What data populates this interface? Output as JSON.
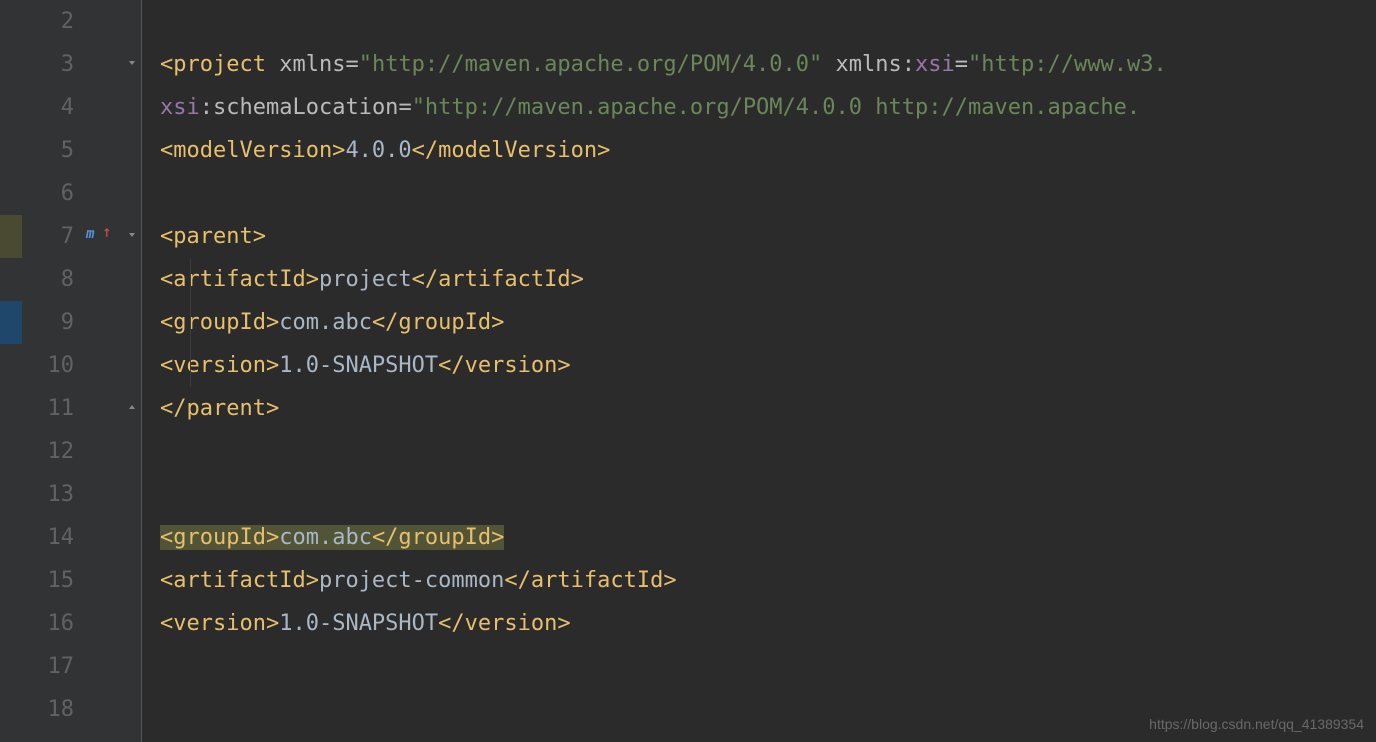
{
  "gutter": {
    "lines": [
      "2",
      "3",
      "4",
      "5",
      "6",
      "7",
      "8",
      "9",
      "10",
      "11",
      "12",
      "13",
      "14",
      "15",
      "16",
      "17",
      "18"
    ]
  },
  "code": {
    "l3": {
      "project_open": "<project",
      "sp1": " ",
      "xmlns": "xmlns",
      "eq": "=",
      "xmlns_val": "\"http://maven.apache.org/POM/4.0.0\"",
      "sp2": " ",
      "xmlns2": "xmlns",
      "colon": ":",
      "xsi": "xsi",
      "eq2": "=",
      "xsi_val": "\"http://www.w3."
    },
    "l4": {
      "xsi": "xsi",
      "colon": ":",
      "schemaLocation": "schemaLocation",
      "eq": "=",
      "val": "\"http://maven.apache.org/POM/4.0.0 http://maven.apache."
    },
    "l5": {
      "open": "<modelVersion>",
      "val": "4.0.0",
      "close": "</modelVersion>"
    },
    "l7": {
      "open": "<parent>"
    },
    "l8": {
      "open": "<artifactId>",
      "val": "project",
      "close": "</artifactId>"
    },
    "l9": {
      "open": "<groupId>",
      "val": "com.abc",
      "close": "</groupId>"
    },
    "l10": {
      "open": "<version>",
      "val": "1.0-SNAPSHOT",
      "close": "</version>"
    },
    "l11": {
      "close": "</parent>"
    },
    "l14": {
      "open": "<groupId>",
      "val": "com.abc",
      "close": "</groupId>"
    },
    "l15": {
      "open": "<artifactId>",
      "val": "project-common",
      "close": "</artifactId>"
    },
    "l16": {
      "open": "<version>",
      "val": "1.0-SNAPSHOT",
      "close": "</version>"
    }
  },
  "icons": {
    "maven_m": "m",
    "maven_arrow": "↑"
  },
  "watermark": "https://blog.csdn.net/qq_41389354"
}
